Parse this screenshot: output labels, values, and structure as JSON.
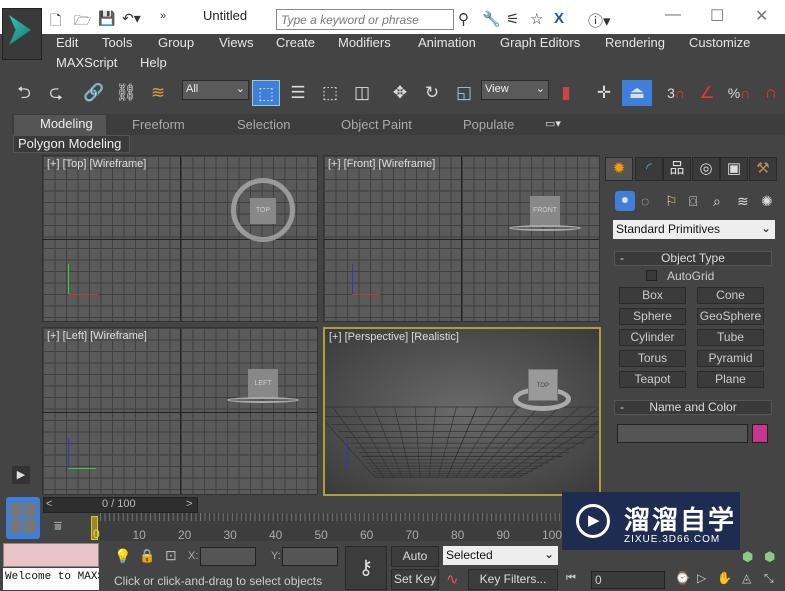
{
  "title": "Untitled",
  "search": {
    "placeholder": "Type a keyword or phrase"
  },
  "menu": [
    "Edit",
    "Tools",
    "Group",
    "Views",
    "Create",
    "Modifiers",
    "Animation",
    "Graph Editors",
    "Rendering",
    "Customize",
    "MAXScript",
    "Help"
  ],
  "toolbar": {
    "selection_filter": "All",
    "ref_coord": "View",
    "snap_labels": [
      "3",
      "%"
    ]
  },
  "ribbon": {
    "tabs": [
      "Modeling",
      "Freeform",
      "Selection",
      "Object Paint",
      "Populate"
    ],
    "active": "Modeling",
    "panel": "Polygon Modeling"
  },
  "viewports": [
    {
      "label": "[+] [Top] [Wireframe]",
      "object": "TOP"
    },
    {
      "label": "[+] [Front] [Wireframe]",
      "object": "FRONT"
    },
    {
      "label": "[+] [Left] [Wireframe]",
      "object": "LEFT"
    },
    {
      "label": "[+] [Perspective] [Realistic]",
      "object": "TOP FRONT",
      "active": true
    }
  ],
  "command_panel": {
    "category": "Standard Primitives",
    "object_type_title": "Object Type",
    "autogrid": "AutoGrid",
    "buttons": [
      "Box",
      "Cone",
      "Sphere",
      "GeoSphere",
      "Cylinder",
      "Tube",
      "Torus",
      "Pyramid",
      "Teapot",
      "Plane"
    ],
    "name_color_title": "Name and Color",
    "object_color": "#c8358f"
  },
  "timeline": {
    "frame": "0 / 100",
    "ticks": [
      "0",
      "10",
      "20",
      "30",
      "40",
      "50",
      "60",
      "70",
      "80",
      "90",
      "100"
    ]
  },
  "status": {
    "maxscript": "Welcome to MAXS",
    "prompt": "Click or click-and-drag to select objects",
    "x_label": "X:",
    "y_label": "Y:",
    "auto_key": "Auto Key",
    "set_key": "Set Key",
    "key_mode": "Selected",
    "key_filters": "Key Filters...",
    "frame_field": "0"
  },
  "watermark": {
    "name": "溜溜自学",
    "url": "ZIXUE.3D66.COM"
  },
  "colors": {
    "accent": "#3d7fd9",
    "active_viewport": "#b79a3e"
  }
}
